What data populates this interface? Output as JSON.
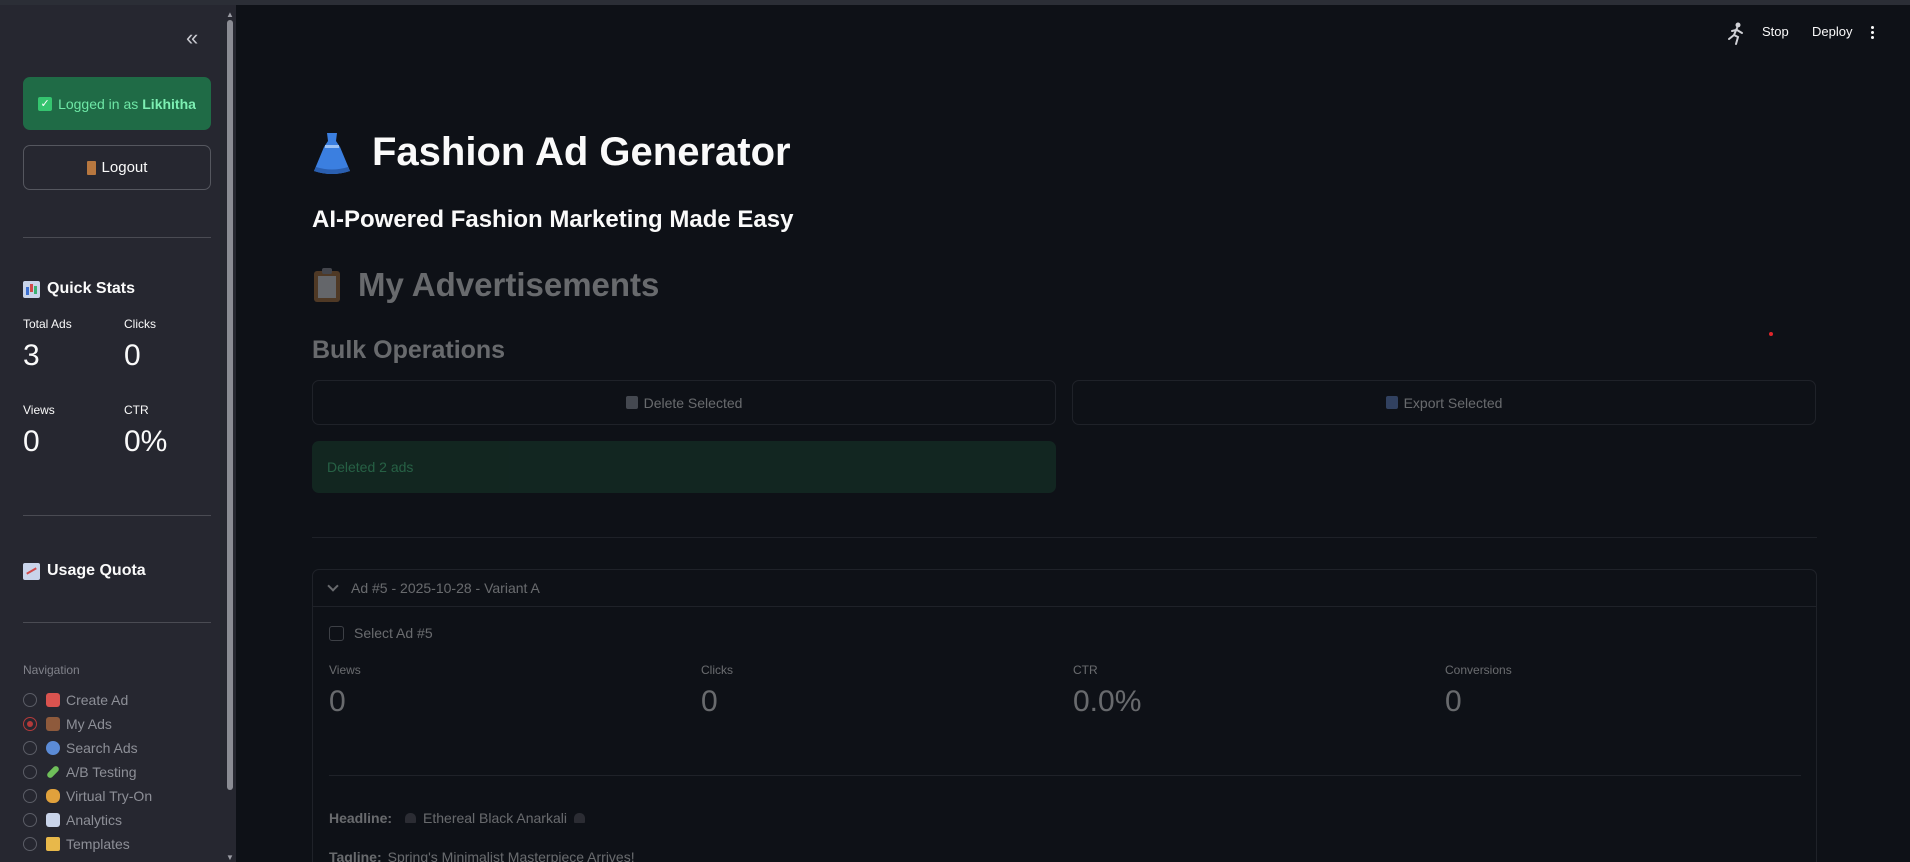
{
  "sidebar": {
    "collapse_icon": "double-chevron-left-icon",
    "login": {
      "prefix": "Logged in as",
      "user": "Likhitha"
    },
    "logout_label": "Logout",
    "quick_stats": {
      "title": "Quick Stats",
      "metrics": [
        {
          "label": "Total Ads",
          "value": "3"
        },
        {
          "label": "Clicks",
          "value": "0"
        },
        {
          "label": "Views",
          "value": "0"
        },
        {
          "label": "CTR",
          "value": "0%"
        }
      ]
    },
    "usage_quota_title": "Usage Quota",
    "navigation": {
      "label": "Navigation",
      "selected": "My Ads",
      "items": [
        {
          "label": "Create Ad",
          "icon": "palette-icon",
          "color": "#d9534f"
        },
        {
          "label": "My Ads",
          "icon": "notebook-icon",
          "color": "#8e5a3c"
        },
        {
          "label": "Search Ads",
          "icon": "magnifier-icon",
          "color": "#5b8bd6"
        },
        {
          "label": "A/B Testing",
          "icon": "test-tube-icon",
          "color": "#6fbf5a"
        },
        {
          "label": "Virtual Try-On",
          "icon": "hand-icon",
          "color": "#e0a13c"
        },
        {
          "label": "Analytics",
          "icon": "bar-chart-icon",
          "color": "#c9d4ea"
        },
        {
          "label": "Templates",
          "icon": "folder-icon",
          "color": "#e8b84a"
        }
      ]
    }
  },
  "header": {
    "stop_label": "Stop",
    "deploy_label": "Deploy"
  },
  "main": {
    "title": "Fashion Ad Generator",
    "subtitle": "AI-Powered Fashion Marketing Made Easy",
    "section_title": "My Advertisements",
    "bulk_title": "Bulk Operations",
    "delete_label": "Delete Selected",
    "export_label": "Export Selected",
    "success_message": "Deleted 2 ads",
    "ad": {
      "header": "Ad #5 - 2025-10-28 - Variant A",
      "select_label": "Select Ad #5",
      "metrics": [
        {
          "label": "Views",
          "value": "0"
        },
        {
          "label": "Clicks",
          "value": "0"
        },
        {
          "label": "CTR",
          "value": "0.0%"
        },
        {
          "label": "Conversions",
          "value": "0"
        }
      ],
      "headline_label": "Headline:",
      "headline_value": "Ethereal Black Anarkali",
      "tagline_label": "Tagline:",
      "tagline_value": "Spring's Minimalist Masterpiece Arrives!"
    }
  },
  "colors": {
    "background": "#0e1117",
    "sidebar": "#262730",
    "success_bg": "#1f6b46",
    "radio_selected": "#b33a3a"
  }
}
